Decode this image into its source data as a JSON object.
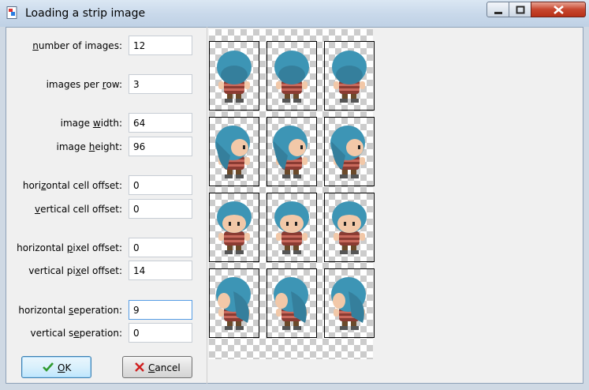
{
  "window": {
    "title": "Loading a strip image"
  },
  "form": {
    "number_of_images": {
      "label_pre": "",
      "label_key": "n",
      "label_post": "umber of images:",
      "value": "12"
    },
    "images_per_row": {
      "label_pre": "images per ",
      "label_key": "r",
      "label_post": "ow:",
      "value": "3"
    },
    "image_width": {
      "label_pre": "image ",
      "label_key": "w",
      "label_post": "idth:",
      "value": "64"
    },
    "image_height": {
      "label_pre": "image ",
      "label_key": "h",
      "label_post": "eight:",
      "value": "96"
    },
    "horizontal_cell_offset": {
      "label_pre": "hori",
      "label_key": "z",
      "label_post": "ontal cell offset:",
      "value": "0"
    },
    "vertical_cell_offset": {
      "label_pre": "",
      "label_key": "v",
      "label_post": "ertical cell offset:",
      "value": "0"
    },
    "horizontal_pixel_offset": {
      "label_pre": "horizontal ",
      "label_key": "p",
      "label_post": "ixel offset:",
      "value": "0"
    },
    "vertical_pixel_offset": {
      "label_pre": "vertical pi",
      "label_key": "x",
      "label_post": "el offset:",
      "value": "14"
    },
    "horizontal_seperation": {
      "label_pre": "horizontal ",
      "label_key": "s",
      "label_post": "eperation:",
      "value": "9"
    },
    "vertical_seperation": {
      "label_pre": "vertical s",
      "label_key": "e",
      "label_post": "peration:",
      "value": "0"
    }
  },
  "buttons": {
    "ok": {
      "key": "O",
      "rest": "K",
      "icon": "check-icon"
    },
    "cancel": {
      "key": "C",
      "rest": "ancel",
      "icon": "x-icon"
    }
  },
  "preview": {
    "rows": 4,
    "columns": 3,
    "directions": [
      "back",
      "side",
      "front",
      "side-back"
    ],
    "hair_color": "#3d95b5",
    "skin_color": "#f2c8a8",
    "shirt_color": "#8a3b32"
  }
}
